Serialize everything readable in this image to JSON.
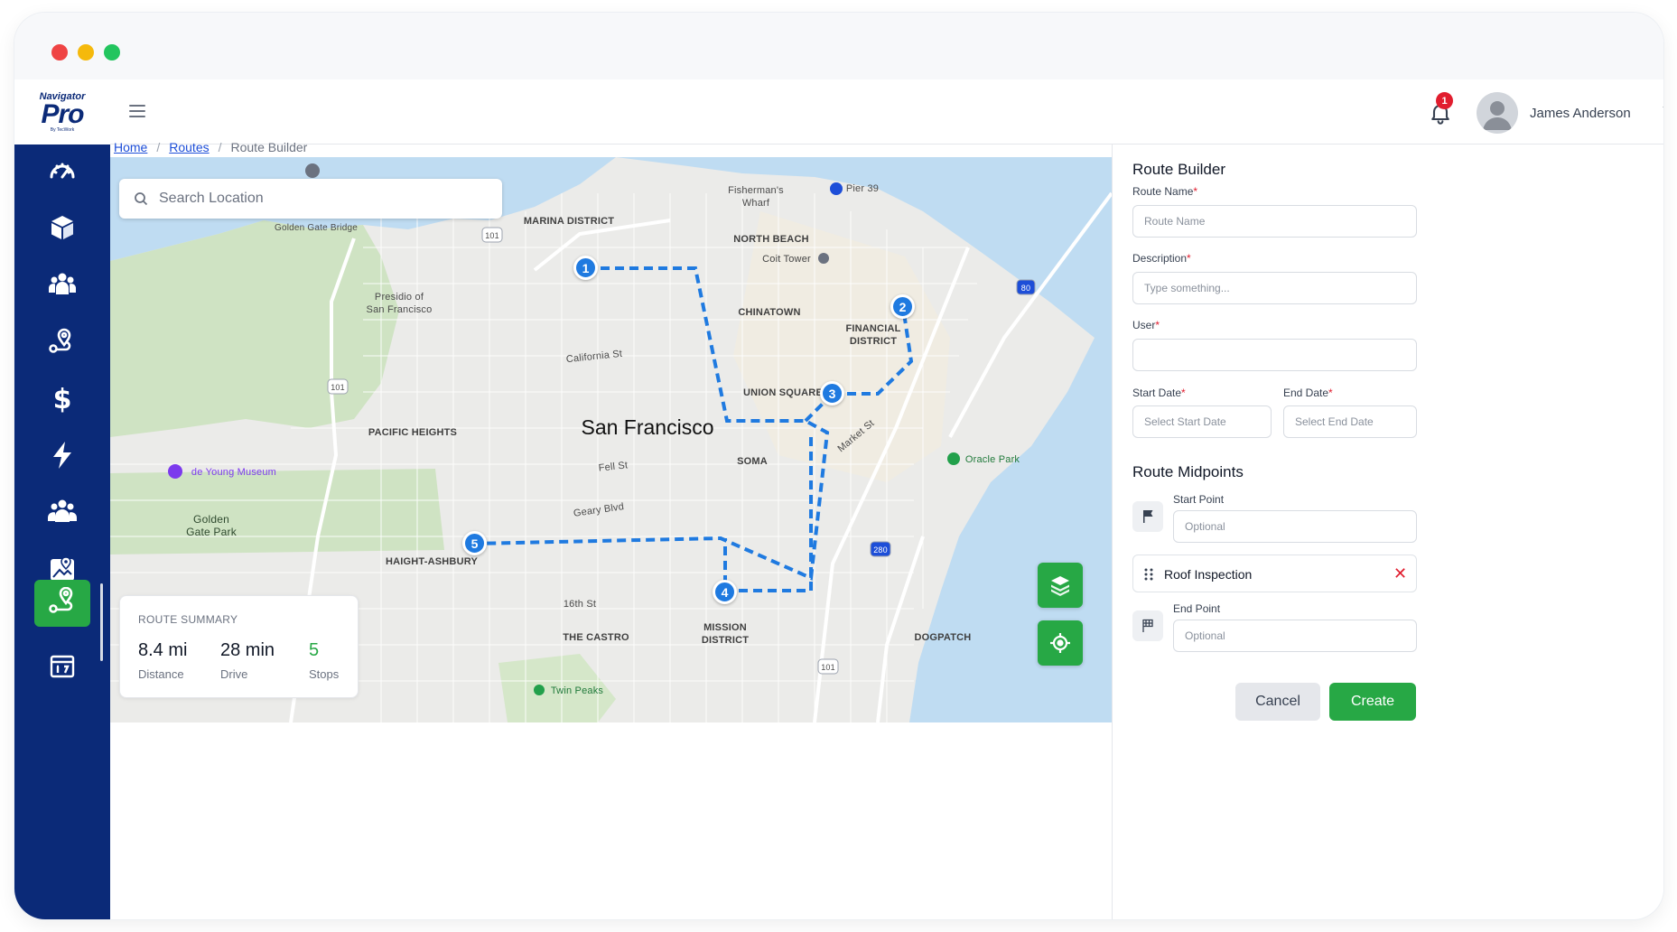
{
  "app": {
    "logo": {
      "top": "Navigator",
      "main": "Pro",
      "sub": "By TecWork"
    },
    "user_name": "James Anderson",
    "notification_count": "1"
  },
  "sidebar": {
    "items": [
      {
        "icon": "dashboard-gauge-icon",
        "active": false
      },
      {
        "icon": "package-icon",
        "active": false
      },
      {
        "icon": "team-icon",
        "active": false
      },
      {
        "icon": "location-pin-icon",
        "active": false
      },
      {
        "icon": "dollar-icon",
        "active": false
      },
      {
        "icon": "lightning-icon",
        "active": false
      },
      {
        "icon": "users-icon",
        "active": false
      },
      {
        "icon": "map-view-icon",
        "active": false
      },
      {
        "icon": "route-icon",
        "active": true
      },
      {
        "icon": "calendar-icon",
        "active": false
      }
    ]
  },
  "breadcrumb": {
    "home": "Home",
    "routes": "Routes",
    "current": "Route Builder",
    "separator": "/"
  },
  "map": {
    "search_placeholder": "Search Location",
    "city": "San Francisco",
    "labels": {
      "marina": "MARINA DISTRICT",
      "fishermans": "Fisherman's\nWharf",
      "pier39": "Pier 39",
      "north_beach": "NORTH BEACH",
      "coit": "Coit Tower",
      "chinatown": "CHINATOWN",
      "financial": "FINANCIAL\nDISTRICT",
      "union": "UNION SQUARE",
      "presidio": "Presidio of\nSan Francisco",
      "golden_gate_bridge": "Golden Gate Bridge",
      "california": "California St",
      "pacific_heights": "PACIFIC HEIGHTS",
      "soma": "SOMA",
      "fell": "Fell St",
      "geary": "Geary Blvd",
      "market": "Market St",
      "oracle": "Oracle Park",
      "de_young": "de Young Museum",
      "golden_gate_park": "Golden\nGate Park",
      "haight": "HAIGHT-ASHBURY",
      "sixteenth": "16th St",
      "castro": "THE CASTRO",
      "mission": "MISSION\nDISTRICT",
      "dogpatch": "DOGPATCH",
      "twin_peaks": "Twin Peaks",
      "hwy101a": "101",
      "hwy101b": "101",
      "hwy101c": "101",
      "hwy80": "80",
      "hwy280": "280"
    },
    "stops": [
      "1",
      "2",
      "3",
      "4",
      "5"
    ],
    "route_color": "#1f7ae0"
  },
  "summary": {
    "title": "ROUTE SUMMARY",
    "distance_value": "8.4 mi",
    "distance_label": "Distance",
    "drive_value": "28 min",
    "drive_label": "Drive",
    "stops_value": "5",
    "stops_label": "Stops"
  },
  "panel": {
    "title": "Route Builder",
    "route_name_label": "Route Name",
    "route_name_placeholder": "Route Name",
    "description_label": "Description",
    "description_placeholder": "Type something...",
    "user_label": "User",
    "user_value": "",
    "start_date_label": "Start Date",
    "start_date_placeholder": "Select Start Date",
    "end_date_label": "End Date",
    "end_date_placeholder": "Select End Date",
    "required_mark": "*",
    "midpoints_title": "Route Midpoints",
    "start_point_label": "Start Point",
    "start_point_placeholder": "Optional",
    "midpoint_name": "Roof Inspection",
    "remove_symbol": "✕",
    "end_point_label": "End Point",
    "end_point_placeholder": "Optional",
    "cancel_label": "Cancel",
    "create_label": "Create"
  },
  "colors": {
    "brand_navy": "#0b2a78",
    "accent_green": "#27a845",
    "route_blue": "#1f7ae0",
    "danger_red": "#e11d2e"
  }
}
